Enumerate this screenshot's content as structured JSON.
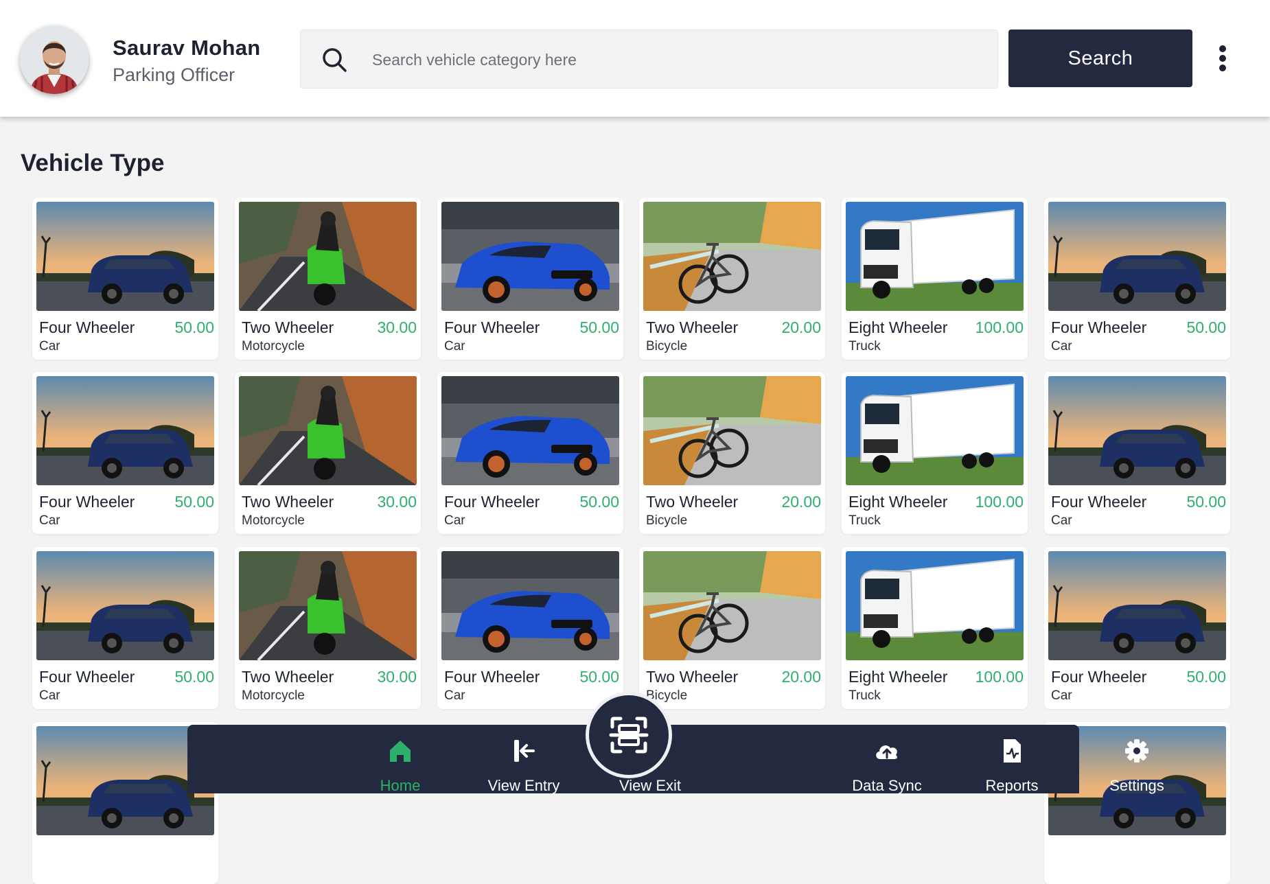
{
  "user": {
    "name": "Saurav Mohan",
    "role": "Parking Officer"
  },
  "search": {
    "placeholder": "Search vehicle category here",
    "button_label": "Search"
  },
  "section_title": "Vehicle Type",
  "cards": [
    {
      "title": "Four Wheeler",
      "subtitle": "Car",
      "price": "50.00",
      "image": "suv"
    },
    {
      "title": "Two Wheeler",
      "subtitle": "Motorcycle",
      "price": "30.00",
      "image": "motorcycle"
    },
    {
      "title": "Four Wheeler",
      "subtitle": "Car",
      "price": "50.00",
      "image": "sports-car"
    },
    {
      "title": "Two Wheeler",
      "subtitle": "Bicycle",
      "price": "20.00",
      "image": "bicycle"
    },
    {
      "title": "Eight Wheeler",
      "subtitle": "Truck",
      "price": "100.00",
      "image": "truck"
    },
    {
      "title": "Four Wheeler",
      "subtitle": "Car",
      "price": "50.00",
      "image": "suv"
    },
    {
      "title": "Four Wheeler",
      "subtitle": "Car",
      "price": "50.00",
      "image": "suv"
    },
    {
      "title": "Two Wheeler",
      "subtitle": "Motorcycle",
      "price": "30.00",
      "image": "motorcycle"
    },
    {
      "title": "Four Wheeler",
      "subtitle": "Car",
      "price": "50.00",
      "image": "sports-car"
    },
    {
      "title": "Two Wheeler",
      "subtitle": "Bicycle",
      "price": "20.00",
      "image": "bicycle"
    },
    {
      "title": "Eight Wheeler",
      "subtitle": "Truck",
      "price": "100.00",
      "image": "truck"
    },
    {
      "title": "Four Wheeler",
      "subtitle": "Car",
      "price": "50.00",
      "image": "suv"
    },
    {
      "title": "Four Wheeler",
      "subtitle": "Car",
      "price": "50.00",
      "image": "suv"
    },
    {
      "title": "Two Wheeler",
      "subtitle": "Motorcycle",
      "price": "30.00",
      "image": "motorcycle"
    },
    {
      "title": "Four Wheeler",
      "subtitle": "Car",
      "price": "50.00",
      "image": "sports-car"
    },
    {
      "title": "Two Wheeler",
      "subtitle": "Bicycle",
      "price": "20.00",
      "image": "bicycle"
    },
    {
      "title": "Eight Wheeler",
      "subtitle": "Truck",
      "price": "100.00",
      "image": "truck"
    },
    {
      "title": "Four Wheeler",
      "subtitle": "Car",
      "price": "50.00",
      "image": "suv"
    }
  ],
  "partial_row_images": [
    "suv",
    "suv"
  ],
  "nav": {
    "items": [
      {
        "label": "Home",
        "icon": "home-icon",
        "active": true
      },
      {
        "label": "View Entry",
        "icon": "entry-icon",
        "active": false
      },
      {
        "label": "View Exit",
        "icon": "exit-icon",
        "active": false
      },
      {
        "label": "Data Sync",
        "icon": "cloud-upload-icon",
        "active": false
      },
      {
        "label": "Reports",
        "icon": "report-icon",
        "active": false
      },
      {
        "label": "Settings",
        "icon": "gear-icon",
        "active": false
      }
    ],
    "scan_icon": "scan-icon"
  },
  "colors": {
    "primary": "#232a40",
    "accent": "#2eaf6b",
    "background": "#f3f3f3"
  }
}
